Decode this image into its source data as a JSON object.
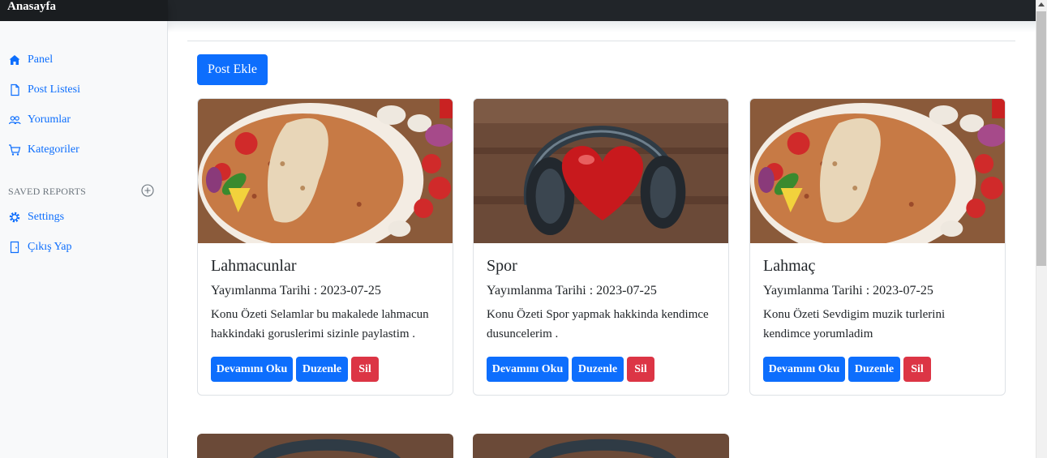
{
  "brand": "Anasayfa",
  "sidebar": {
    "items": [
      {
        "label": "Panel",
        "icon": "home-icon"
      },
      {
        "label": "Post Listesi",
        "icon": "file-icon"
      },
      {
        "label": "Yorumlar",
        "icon": "users-icon"
      },
      {
        "label": "Kategoriler",
        "icon": "cart-icon"
      }
    ],
    "reports_heading": "SAVED REPORTS",
    "reports_items": [
      {
        "label": "Settings",
        "icon": "gear-icon"
      },
      {
        "label": "Çıkış Yap",
        "icon": "logout-icon"
      }
    ]
  },
  "main": {
    "add_button": "Post Ekle",
    "cards": [
      {
        "title": "Lahmacunlar",
        "date": "Yayımlanma Tarihi : 2023-07-25",
        "summary": "Konu Özeti Selamlar bu makalede lahmacun hakkindaki goruslerimi sizinle paylastim .",
        "image": "food-image"
      },
      {
        "title": "Spor",
        "date": "Yayımlanma Tarihi : 2023-07-25",
        "summary": "Konu Özeti Spor yapmak hakkinda kendimce dusuncelerim .",
        "image": "headphones-heart-image"
      },
      {
        "title": "Lahmaç",
        "date": "Yayımlanma Tarihi : 2023-07-25",
        "summary": "Konu Özeti Sevdigim muzik turlerini kendimce yorumladim",
        "image": "food-image"
      }
    ],
    "buttons": {
      "read": "Devamını Oku",
      "edit": "Duzenle",
      "delete": "Sil"
    }
  },
  "colors": {
    "primary": "#0d6efd",
    "danger": "#dc3545",
    "topbar": "#212529",
    "sidebar": "#f8f9fa"
  }
}
